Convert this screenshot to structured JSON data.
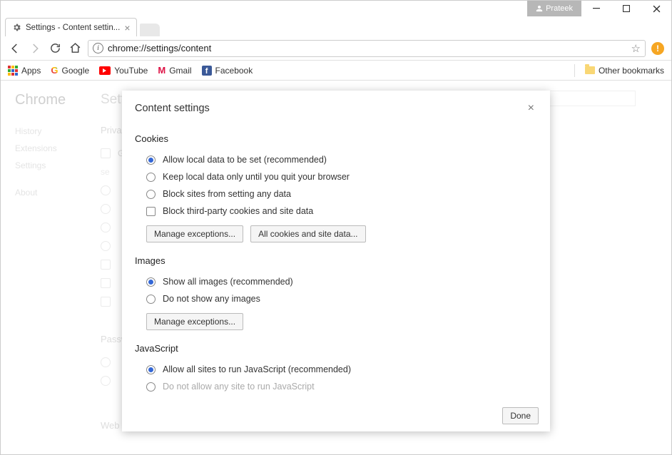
{
  "window": {
    "user_label": "Prateek"
  },
  "tab": {
    "title": "Settings - Content settin..."
  },
  "address_bar": {
    "url": "chrome://settings/content"
  },
  "bookmarks": {
    "apps": "Apps",
    "google": "Google",
    "youtube": "YouTube",
    "gmail": "Gmail",
    "facebook": "Facebook",
    "other": "Other bookmarks"
  },
  "bg_page": {
    "heading": "Chrome",
    "side_nav": [
      "History",
      "Extensions",
      "Settings",
      "",
      "About"
    ],
    "main_heading": "Settings",
    "section_privacy": "Privacy",
    "section_passwords": "Passwords",
    "section_web": "Web content"
  },
  "modal": {
    "title": "Content settings",
    "done": "Done",
    "sections": {
      "cookies": {
        "title": "Cookies",
        "options": [
          "Allow local data to be set (recommended)",
          "Keep local data only until you quit your browser",
          "Block sites from setting any data"
        ],
        "checkbox": "Block third-party cookies and site data",
        "btn_manage": "Manage exceptions...",
        "btn_all_cookies": "All cookies and site data..."
      },
      "images": {
        "title": "Images",
        "options": [
          "Show all images (recommended)",
          "Do not show any images"
        ],
        "btn_manage": "Manage exceptions..."
      },
      "javascript": {
        "title": "JavaScript",
        "options": [
          "Allow all sites to run JavaScript (recommended)",
          "Do not allow any site to run JavaScript"
        ]
      }
    }
  }
}
